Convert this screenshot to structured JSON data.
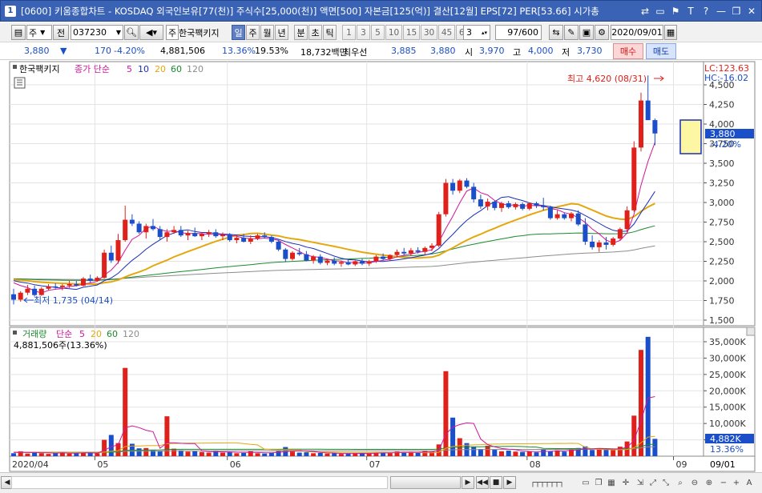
{
  "window": {
    "icon_label": "1",
    "title": "[0600] 키움종합차트 - KOSDAQ 외국인보유[77(천)] 주식수[25,000(천)] 액면[500] 자본금[125(억)] 결산[12월] EPS[72] PER[53.66] 시가총",
    "controls": [
      "⇄",
      "▭",
      "⚑",
      "T",
      "?",
      "—",
      "❐",
      "✕"
    ]
  },
  "toolbar": {
    "market_type": "주",
    "range_type": "전",
    "code": "037230",
    "stock_name": "한국팩키지",
    "stock_tag": "주",
    "periods": [
      "일",
      "주",
      "월",
      "년",
      "분",
      "초",
      "틱"
    ],
    "selected_period": "일",
    "intervals": [
      "1",
      "3",
      "5",
      "10",
      "15",
      "30",
      "45",
      "60"
    ],
    "interval_input": "3",
    "count": "97/600",
    "date": "2020/09/01"
  },
  "quote": {
    "price": "3,880",
    "change_arrow": "▼",
    "change": "170",
    "change_pct": "-4.20%",
    "volume": "4,881,506",
    "volume_ratio": "13.36%",
    "turnover": "19.53%",
    "amount": "18,732백만",
    "best_label": "최우선",
    "best_ask": "3,885",
    "best_bid": "3,880",
    "open_label": "시",
    "open": "3,970",
    "high_label": "고",
    "high": "4,000",
    "low_label": "저",
    "low": "3,730",
    "buy_label": "매수",
    "sell_label": "매도"
  },
  "price_pane": {
    "legend_name": "한국팩키지",
    "legend_ma_label": "종가 단순",
    "legend_ma_periods": [
      "5",
      "10",
      "20",
      "60",
      "120"
    ],
    "lc_text": "LC:123.63",
    "hc_text": "HC:-16.02",
    "high_annotation": "최고 4,620 (08/31)",
    "low_annotation": "최저 1,735 (04/14)",
    "current_price_tag": "3,880",
    "current_change_tag": "-4.20%",
    "y_ticks": [
      "4,500",
      "4,250",
      "4,000",
      "3,750",
      "3,500",
      "3,250",
      "3,000",
      "2,750",
      "2,500",
      "2,250",
      "2,000",
      "1,750",
      "1,500"
    ]
  },
  "volume_pane": {
    "legend_name": "거래량",
    "legend_ma_label": "단순",
    "legend_ma_periods": [
      "5",
      "20",
      "60",
      "120"
    ],
    "current_text": "4,881,506주(13.36%)",
    "current_tag": "4,882K",
    "current_pct_tag": "13.36%",
    "y_ticks": [
      "35,000K",
      "30,000K",
      "25,000K",
      "20,000K",
      "15,000K",
      "10,000K",
      "5,000K"
    ]
  },
  "x_axis": {
    "labels": [
      "2020/04",
      "05",
      "06",
      "07",
      "08",
      "09"
    ],
    "right_label": "09/01"
  },
  "colors": {
    "up": "#e0211b",
    "down": "#1b4ec9",
    "ma5": "#d0169b",
    "ma10": "#1b2fb5",
    "ma20": "#e4a80e",
    "ma60": "#1c8a2c",
    "ma120": "#8c8c8c"
  },
  "chart_data": {
    "type": "candlestick",
    "price_ylim": [
      1500,
      4620
    ],
    "volume_ylim": [
      0,
      37000
    ],
    "candles": [
      [
        1830,
        1900,
        1700,
        1760
      ],
      [
        1760,
        1870,
        1735,
        1850
      ],
      [
        1850,
        1950,
        1820,
        1900
      ],
      [
        1900,
        1940,
        1800,
        1820
      ],
      [
        1820,
        1920,
        1810,
        1900
      ],
      [
        1900,
        1960,
        1880,
        1930
      ],
      [
        1930,
        1970,
        1900,
        1920
      ],
      [
        1920,
        1960,
        1880,
        1940
      ],
      [
        1940,
        2000,
        1910,
        1960
      ],
      [
        1960,
        2000,
        1930,
        1940
      ],
      [
        1940,
        2050,
        1930,
        2030
      ],
      [
        2030,
        2080,
        1980,
        2000
      ],
      [
        2000,
        2060,
        1990,
        2040
      ],
      [
        2040,
        2400,
        2030,
        2360
      ],
      [
        2360,
        2450,
        2230,
        2260
      ],
      [
        2260,
        2600,
        2220,
        2520
      ],
      [
        2520,
        2960,
        2500,
        2780
      ],
      [
        2780,
        2850,
        2700,
        2730
      ],
      [
        2730,
        2760,
        2600,
        2620
      ],
      [
        2620,
        2730,
        2540,
        2700
      ],
      [
        2700,
        2790,
        2640,
        2660
      ],
      [
        2660,
        2700,
        2520,
        2560
      ],
      [
        2560,
        2660,
        2500,
        2620
      ],
      [
        2620,
        2700,
        2600,
        2650
      ],
      [
        2650,
        2700,
        2560,
        2580
      ],
      [
        2580,
        2640,
        2520,
        2610
      ],
      [
        2610,
        2680,
        2560,
        2570
      ],
      [
        2570,
        2620,
        2520,
        2600
      ],
      [
        2600,
        2650,
        2560,
        2620
      ],
      [
        2620,
        2660,
        2550,
        2570
      ],
      [
        2570,
        2620,
        2520,
        2590
      ],
      [
        2590,
        2610,
        2500,
        2520
      ],
      [
        2520,
        2580,
        2480,
        2550
      ],
      [
        2550,
        2600,
        2490,
        2500
      ],
      [
        2500,
        2580,
        2470,
        2540
      ],
      [
        2540,
        2600,
        2520,
        2580
      ],
      [
        2580,
        2620,
        2540,
        2560
      ],
      [
        2560,
        2580,
        2480,
        2500
      ],
      [
        2500,
        2520,
        2380,
        2400
      ],
      [
        2400,
        2420,
        2240,
        2280
      ],
      [
        2280,
        2380,
        2260,
        2360
      ],
      [
        2360,
        2420,
        2320,
        2340
      ],
      [
        2340,
        2380,
        2250,
        2260
      ],
      [
        2260,
        2330,
        2220,
        2310
      ],
      [
        2310,
        2340,
        2210,
        2230
      ],
      [
        2230,
        2280,
        2200,
        2260
      ],
      [
        2260,
        2300,
        2200,
        2220
      ],
      [
        2220,
        2260,
        2180,
        2240
      ],
      [
        2240,
        2280,
        2200,
        2210
      ],
      [
        2210,
        2260,
        2190,
        2250
      ],
      [
        2250,
        2280,
        2200,
        2220
      ],
      [
        2220,
        2270,
        2190,
        2250
      ],
      [
        2250,
        2330,
        2230,
        2310
      ],
      [
        2310,
        2350,
        2260,
        2280
      ],
      [
        2280,
        2340,
        2260,
        2330
      ],
      [
        2330,
        2400,
        2300,
        2370
      ],
      [
        2370,
        2420,
        2330,
        2350
      ],
      [
        2350,
        2420,
        2320,
        2390
      ],
      [
        2390,
        2430,
        2350,
        2370
      ],
      [
        2370,
        2440,
        2340,
        2420
      ],
      [
        2420,
        2480,
        2380,
        2450
      ],
      [
        2450,
        2880,
        2430,
        2850
      ],
      [
        2850,
        3300,
        2820,
        3250
      ],
      [
        3250,
        3300,
        3100,
        3150
      ],
      [
        3150,
        3300,
        3120,
        3280
      ],
      [
        3280,
        3310,
        3180,
        3200
      ],
      [
        3200,
        3250,
        3000,
        3040
      ],
      [
        3040,
        3100,
        2920,
        2950
      ],
      [
        2950,
        3050,
        2900,
        3010
      ],
      [
        3010,
        3020,
        2900,
        2930
      ],
      [
        2930,
        3010,
        2880,
        2990
      ],
      [
        2990,
        3020,
        2920,
        2940
      ],
      [
        2940,
        3000,
        2910,
        2980
      ],
      [
        2980,
        3000,
        2900,
        2920
      ],
      [
        2920,
        3000,
        2900,
        2990
      ],
      [
        2990,
        3010,
        2930,
        2960
      ],
      [
        2960,
        3060,
        2900,
        2940
      ],
      [
        2940,
        2960,
        2780,
        2800
      ],
      [
        2800,
        2900,
        2780,
        2850
      ],
      [
        2850,
        2870,
        2780,
        2800
      ],
      [
        2800,
        2880,
        2760,
        2860
      ],
      [
        2860,
        2900,
        2700,
        2720
      ],
      [
        2720,
        2800,
        2460,
        2500
      ],
      [
        2500,
        2580,
        2400,
        2430
      ],
      [
        2430,
        2520,
        2370,
        2490
      ],
      [
        2490,
        2560,
        2400,
        2460
      ],
      [
        2460,
        2560,
        2440,
        2540
      ],
      [
        2540,
        2680,
        2520,
        2660
      ],
      [
        2660,
        2950,
        2620,
        2900
      ],
      [
        2900,
        3780,
        2880,
        3700
      ],
      [
        3700,
        4400,
        3650,
        4300
      ],
      [
        4300,
        4620,
        4050,
        4050
      ],
      [
        4050,
        4070,
        3730,
        3880
      ]
    ],
    "volumes": [
      900,
      1500,
      800,
      1200,
      900,
      700,
      1000,
      1300,
      800,
      900,
      1000,
      1100,
      900,
      5000,
      6500,
      4000,
      27000,
      3800,
      2400,
      2500,
      1800,
      1600,
      12200,
      2300,
      1800,
      1400,
      1500,
      1300,
      1100,
      1600,
      1100,
      1300,
      900,
      1000,
      1500,
      900,
      800,
      1100,
      1600,
      2800,
      1400,
      1100,
      1200,
      900,
      1000,
      800,
      900,
      700,
      800,
      900,
      1000,
      800,
      1200,
      1100,
      900,
      1400,
      1200,
      1300,
      1000,
      1600,
      1400,
      3600,
      26000,
      11800,
      5500,
      4000,
      2800,
      2200,
      3200,
      2100,
      1500,
      1700,
      1400,
      1300,
      1500,
      1200,
      2000,
      1500,
      1800,
      1400,
      2400,
      2500,
      3000,
      1900,
      2200,
      2000,
      2100,
      2900,
      4500,
      12400,
      32500,
      36500,
      5300
    ],
    "up_color": "#e0211b",
    "down_color": "#1b4ec9"
  }
}
